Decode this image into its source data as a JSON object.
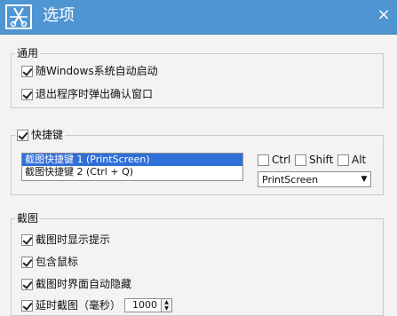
{
  "window": {
    "title": "选项",
    "app_icon": "scissors-app-icon",
    "close_icon": "close-icon"
  },
  "general": {
    "legend": "通用",
    "options": [
      {
        "label": "随Windows系统自动启动",
        "checked": true
      },
      {
        "label": "退出程序时弹出确认窗口",
        "checked": true
      }
    ]
  },
  "hotkey": {
    "legend": "快捷键",
    "enabled": true,
    "list": [
      {
        "label": "截图快捷键 1 (PrintScreen)",
        "selected": true
      },
      {
        "label": "截图快捷键 2 (Ctrl + Q)",
        "selected": false
      }
    ],
    "modifiers": [
      {
        "label": "Ctrl",
        "checked": false
      },
      {
        "label": "Shift",
        "checked": false
      },
      {
        "label": "Alt",
        "checked": false
      }
    ],
    "key_select": "PrintScreen"
  },
  "capture": {
    "legend": "截图",
    "options": [
      {
        "label": "截图时显示提示",
        "checked": true
      },
      {
        "label": "包含鼠标",
        "checked": true
      },
      {
        "label": "截图时界面自动隐藏",
        "checked": true
      },
      {
        "label": "延时截图（毫秒）",
        "checked": true
      }
    ],
    "delay_value": "1000"
  }
}
